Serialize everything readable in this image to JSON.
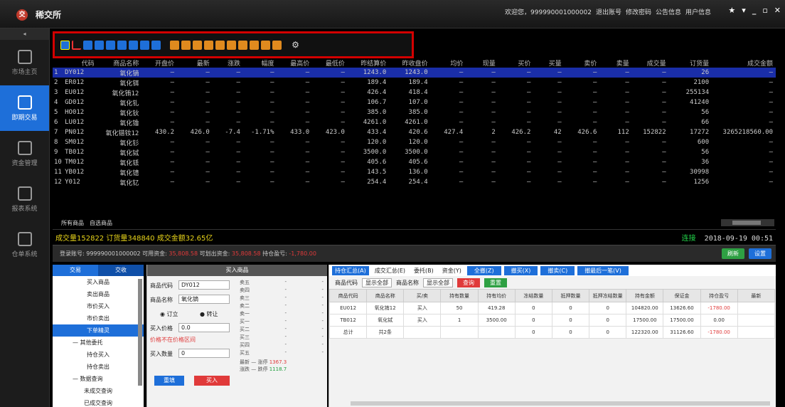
{
  "app": {
    "title": "稀交所",
    "logo": "交",
    "welcome": "欢迎您，999990001000002",
    "links": [
      "退出账号",
      "修改密码",
      "公告信息",
      "用户信息"
    ],
    "window_controls": [
      "▾",
      "_",
      "▫",
      "✕"
    ]
  },
  "sidebar": {
    "collapse": "◂",
    "items": [
      {
        "label": "市场主页",
        "icon": "home-icon",
        "active": false
      },
      {
        "label": "即期交易",
        "icon": "trade-icon",
        "active": true
      },
      {
        "label": "资金管理",
        "icon": "funds-icon",
        "active": false
      },
      {
        "label": "报表系统",
        "icon": "report-icon",
        "active": false
      },
      {
        "label": "仓单系统",
        "icon": "warehouse-icon",
        "active": false
      }
    ]
  },
  "toolbar": {
    "buttons": [
      {
        "icon": "bar-chart-icon",
        "style": "chart"
      },
      {
        "icon": "kline-icon",
        "style": "red"
      },
      {
        "icon": "tick-icon",
        "style": "blue"
      },
      {
        "icon": "list-icon",
        "style": "blue"
      },
      {
        "icon": "grid-icon",
        "style": "blue"
      },
      {
        "icon": "window-icon",
        "style": "blue"
      },
      {
        "icon": "month-icon",
        "style": "blue"
      },
      {
        "icon": "week-icon",
        "style": "blue"
      },
      {
        "icon": "close-x-icon",
        "style": "blue"
      },
      {
        "icon": "tool1-icon",
        "style": "orange"
      },
      {
        "icon": "tool2-icon",
        "style": "orange"
      },
      {
        "icon": "tool3-icon",
        "style": "orange"
      },
      {
        "icon": "tool4-icon",
        "style": "orange"
      },
      {
        "icon": "tool5-icon",
        "style": "orange"
      },
      {
        "icon": "tool6-icon",
        "style": "orange"
      },
      {
        "icon": "tool7-icon",
        "style": "orange"
      },
      {
        "icon": "tool8-icon",
        "style": "orange"
      },
      {
        "icon": "tool9-icon",
        "style": "orange"
      },
      {
        "icon": "edit-icon",
        "style": "orange"
      },
      {
        "icon": "gear-icon",
        "style": "gear"
      }
    ]
  },
  "quotes": {
    "headers": [
      "",
      "代码",
      "商品名称",
      "开盘价",
      "最新",
      "涨跌",
      "幅度",
      "最高价",
      "最低价",
      "昨结算价",
      "昨收盘价",
      "均价",
      "现量",
      "买价",
      "买量",
      "卖价",
      "卖量",
      "成交量",
      "订货量",
      "成交金额"
    ],
    "rows": [
      [
        "1",
        "DY012",
        "氧化镝",
        "—",
        "—",
        "—",
        "—",
        "—",
        "—",
        "1243.0",
        "1243.0",
        "—",
        "—",
        "—",
        "—",
        "—",
        "—",
        "—",
        "26",
        "—"
      ],
      [
        "2",
        "ER012",
        "氧化铒",
        "—",
        "—",
        "—",
        "—",
        "—",
        "—",
        "189.4",
        "189.4",
        "—",
        "—",
        "—",
        "—",
        "—",
        "—",
        "—",
        "2100",
        "—"
      ],
      [
        "3",
        "EU012",
        "氧化铕12",
        "—",
        "—",
        "—",
        "—",
        "—",
        "—",
        "426.4",
        "418.4",
        "—",
        "—",
        "—",
        "—",
        "—",
        "—",
        "—",
        "255134",
        "—"
      ],
      [
        "4",
        "GD012",
        "氧化钆",
        "—",
        "—",
        "—",
        "—",
        "—",
        "—",
        "106.7",
        "107.0",
        "—",
        "—",
        "—",
        "—",
        "—",
        "—",
        "—",
        "41240",
        "—"
      ],
      [
        "5",
        "HO012",
        "氧化钬",
        "—",
        "—",
        "—",
        "—",
        "—",
        "—",
        "385.0",
        "385.0",
        "—",
        "—",
        "—",
        "—",
        "—",
        "—",
        "—",
        "56",
        "—"
      ],
      [
        "6",
        "LU012",
        "氧化镥",
        "—",
        "—",
        "—",
        "—",
        "—",
        "—",
        "4261.0",
        "4261.0",
        "—",
        "—",
        "—",
        "—",
        "—",
        "—",
        "—",
        "66",
        "—"
      ],
      [
        "7",
        "PN012",
        "氧化镨钕12",
        "430.2",
        "426.0",
        "-7.4",
        "-1.71%",
        "433.0",
        "423.0",
        "433.4",
        "420.6",
        "427.4",
        "2",
        "426.2",
        "42",
        "426.6",
        "112",
        "152822",
        "17272",
        "3265218560.00"
      ],
      [
        "8",
        "SM012",
        "氧化钐",
        "—",
        "—",
        "—",
        "—",
        "—",
        "—",
        "120.0",
        "120.0",
        "—",
        "—",
        "—",
        "—",
        "—",
        "—",
        "—",
        "600",
        "—"
      ],
      [
        "9",
        "TB012",
        "氧化铽",
        "—",
        "—",
        "—",
        "—",
        "—",
        "—",
        "3500.0",
        "3500.0",
        "—",
        "—",
        "—",
        "—",
        "—",
        "—",
        "—",
        "56",
        "—"
      ],
      [
        "10",
        "TM012",
        "氧化铥",
        "—",
        "—",
        "—",
        "—",
        "—",
        "—",
        "405.6",
        "405.6",
        "—",
        "—",
        "—",
        "—",
        "—",
        "—",
        "—",
        "36",
        "—"
      ],
      [
        "11",
        "YB012",
        "氧化镱",
        "—",
        "—",
        "—",
        "—",
        "—",
        "—",
        "143.5",
        "136.0",
        "—",
        "—",
        "—",
        "—",
        "—",
        "—",
        "—",
        "30998",
        "—"
      ],
      [
        "12",
        "Y012",
        "氧化钇",
        "—",
        "—",
        "—",
        "—",
        "—",
        "—",
        "254.4",
        "254.4",
        "—",
        "—",
        "—",
        "—",
        "—",
        "—",
        "—",
        "1256",
        "—"
      ]
    ]
  },
  "market_tabs": [
    "所有商品",
    "自选商品"
  ],
  "status": {
    "summary": "成交量152822  订货量348840  成交金额32.65亿",
    "conn": "连接",
    "datetime": "2018-09-19 00:51"
  },
  "account": {
    "label": "登录账号: 999990001000002  可用资金:",
    "available": "35,808.58",
    "withdraw_label": "可划出资金:",
    "withdraw": "35,808.58",
    "pnl_label": "持仓盈亏:",
    "pnl": "-1,780.00",
    "buttons": [
      "刷新",
      "设置"
    ]
  },
  "left_nav": {
    "tabs": [
      "交易",
      "交收"
    ],
    "items": [
      {
        "label": "买入商品",
        "type": "item"
      },
      {
        "label": "卖出商品",
        "type": "item"
      },
      {
        "label": "市价买入",
        "type": "item"
      },
      {
        "label": "市价卖出",
        "type": "item"
      },
      {
        "label": "下单精灵",
        "type": "sel"
      },
      {
        "label": "— 其他委托",
        "type": "head"
      },
      {
        "label": "持仓买入",
        "type": "item"
      },
      {
        "label": "持仓卖出",
        "type": "item"
      },
      {
        "label": "— 数据查询",
        "type": "head"
      },
      {
        "label": "未成交查询",
        "type": "item"
      },
      {
        "label": "已成交查询",
        "type": "item"
      }
    ]
  },
  "order_form": {
    "title": "买入商品",
    "code_label": "商品代码",
    "code_value": "DY012",
    "name_label": "商品名称",
    "name_value": "氧化镝",
    "type_options": [
      "订立",
      "转让"
    ],
    "price_label": "买入价格",
    "price_value": "0.0",
    "price_limit_note": "价格不在价格区间",
    "qty_label": "买入数量",
    "qty_value": "0",
    "reset_button": "重填",
    "buy_button": "买入",
    "book_rows": [
      [
        "卖五",
        "-",
        "-"
      ],
      [
        "卖四",
        "-",
        "-"
      ],
      [
        "卖三",
        "-",
        "-"
      ],
      [
        "卖二",
        "-",
        "-"
      ],
      [
        "卖一",
        "-",
        "-"
      ],
      [
        "买一",
        "-",
        "-"
      ],
      [
        "买二",
        "-",
        "-"
      ],
      [
        "买三",
        "-",
        "-"
      ],
      [
        "买四",
        "-",
        "-"
      ],
      [
        "买五",
        "-",
        "-"
      ]
    ],
    "book_last": [
      "最新",
      "—",
      "涨停",
      "1367.3"
    ],
    "book_last2": [
      "涨跌",
      "—",
      "跌停",
      "1118.7"
    ]
  },
  "positions": {
    "tabs": [
      "持仓汇总(A)",
      "成交汇总(E)",
      "委托(B)",
      "资金(Y)"
    ],
    "actions": [
      "全撤(Z)",
      "撤买(X)",
      "撤卖(C)",
      "撤最后一笔(V)"
    ],
    "filter": {
      "code_label": "商品代码",
      "code_value": "显示全部",
      "name_label": "商品名称",
      "name_value": "显示全部",
      "query_btn": "查询",
      "reset_btn": "重置"
    },
    "headers": [
      "商品代码",
      "商品名称",
      "买/卖",
      "持有数量",
      "持有均价",
      "冻结数量",
      "抵押数量",
      "抵押冻结数量",
      "持有金额",
      "保证金",
      "持仓盈亏",
      "最新"
    ],
    "rows": [
      [
        "EU012",
        "氧化铕12",
        "买入",
        "50",
        "419.28",
        "0",
        "0",
        "0",
        "104820.00",
        "13626.60",
        "-1780.00",
        ""
      ],
      [
        "TB012",
        "氧化铽",
        "买入",
        "1",
        "3500.00",
        "0",
        "0",
        "0",
        "17500.00",
        "17500.00",
        "0.00",
        ""
      ],
      [
        "总计",
        "共2条",
        "",
        "",
        "",
        "0",
        "0",
        "0",
        "122320.00",
        "31126.60",
        "-1780.00",
        ""
      ]
    ]
  }
}
